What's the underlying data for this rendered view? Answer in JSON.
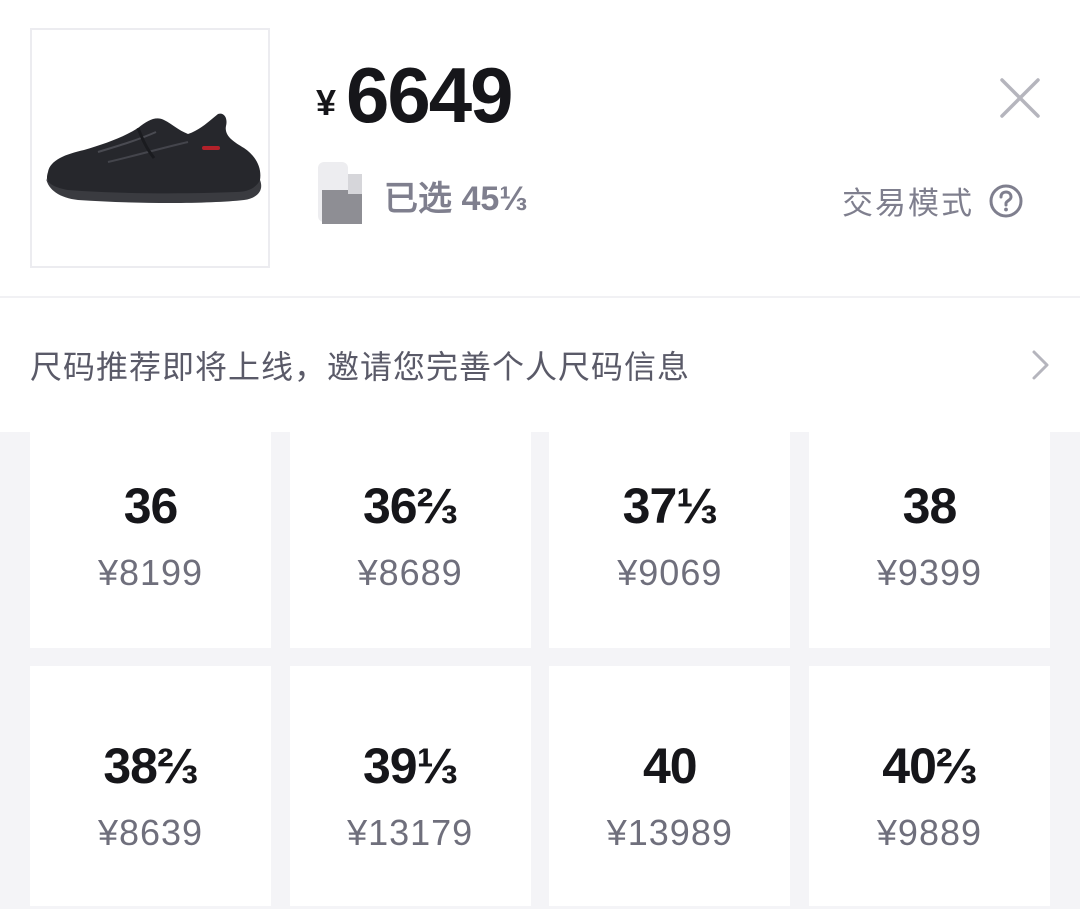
{
  "product": {
    "image_icon": "sneaker-image",
    "currency": "¥",
    "price": "6649",
    "selected_label": "已选 45⅓",
    "close_icon": "close-icon"
  },
  "trade_mode": {
    "label": "交易模式",
    "icon": "question-circle-icon"
  },
  "size_tip": {
    "text": "尺码推荐即将上线，邀请您完善个人尺码信息",
    "icon": "chevron-right-icon"
  },
  "sizes": [
    [
      {
        "size": "36",
        "price": "¥8199"
      },
      {
        "size": "36⅔",
        "price": "¥8689"
      },
      {
        "size": "37⅓",
        "price": "¥9069"
      },
      {
        "size": "38",
        "price": "¥9399"
      }
    ],
    [
      {
        "size": "38⅔",
        "price": "¥8639"
      },
      {
        "size": "39⅓",
        "price": "¥13179"
      },
      {
        "size": "40",
        "price": "¥13989"
      },
      {
        "size": "40⅔",
        "price": "¥9889"
      }
    ]
  ],
  "colors": {
    "text_primary": "#16161a",
    "text_secondary": "#7f7f8e",
    "grid_background": "#f4f4f7"
  }
}
